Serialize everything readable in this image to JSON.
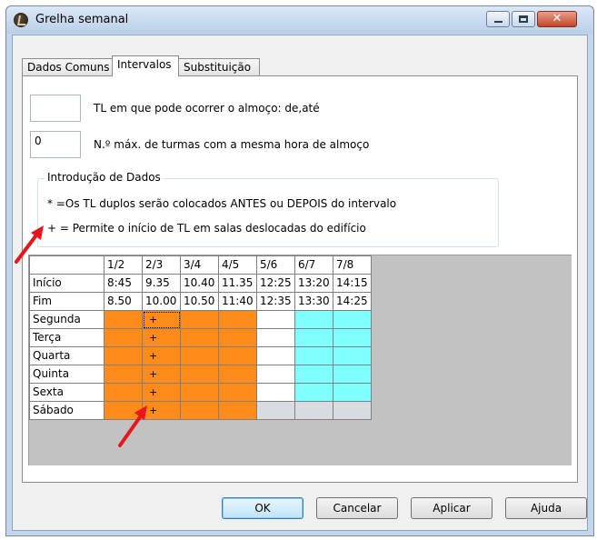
{
  "window": {
    "title": "Grelha semanal",
    "controls": {
      "minimize": "minimize",
      "maximize": "maximize",
      "close": "close"
    }
  },
  "tabs": [
    {
      "label": "Dados Comuns",
      "active": false
    },
    {
      "label": "Intervalos",
      "active": true
    },
    {
      "label": "Substituição",
      "active": false
    }
  ],
  "fields": {
    "lunch_range": {
      "value": "",
      "label": "TL em que pode ocorrer o almoço: de,até"
    },
    "max_classes": {
      "value": "0",
      "label": "N.º máx. de turmas com a mesma hora de almoço"
    }
  },
  "group": {
    "title": "Introdução de Dados",
    "line1": "* =Os TL duplos serão colocados ANTES ou DEPOIS do intervalo",
    "line2": "+ = Permite o início de TL em salas deslocadas do edifício"
  },
  "grid": {
    "columns": [
      "1/2",
      "2/3",
      "3/4",
      "4/5",
      "5/6",
      "6/7",
      "7/8"
    ],
    "time_rows": [
      {
        "label": "Início",
        "values": [
          "8:45",
          "9.35",
          "10.40",
          "11.35",
          "12:25",
          "13:20",
          "14:15"
        ]
      },
      {
        "label": "Fim",
        "values": [
          "8.50",
          "10.00",
          "10.50",
          "11:40",
          "12:35",
          "13:30",
          "14:25"
        ]
      }
    ],
    "day_rows": [
      {
        "label": "Segunda",
        "cells": [
          "orange",
          "orange+",
          "orange",
          "orange",
          "white",
          "cyan",
          "cyan"
        ]
      },
      {
        "label": "Terça",
        "cells": [
          "orange",
          "orange+",
          "orange",
          "orange",
          "white",
          "cyan",
          "cyan"
        ]
      },
      {
        "label": "Quarta",
        "cells": [
          "orange",
          "orange+",
          "orange",
          "orange",
          "white",
          "cyan",
          "cyan"
        ]
      },
      {
        "label": "Quinta",
        "cells": [
          "orange",
          "orange+",
          "orange",
          "orange",
          "white",
          "cyan",
          "cyan"
        ]
      },
      {
        "label": "Sexta",
        "cells": [
          "orange",
          "orange+",
          "orange",
          "orange",
          "white",
          "cyan",
          "cyan"
        ]
      },
      {
        "label": "Sábado",
        "cells": [
          "orange",
          "orange+",
          "orange",
          "orange",
          "gray",
          "gray",
          "gray"
        ]
      }
    ],
    "colors": {
      "orange": "#ff8c1a",
      "cyan": "#80ffff",
      "white": "#ffffff",
      "gray": "#d8dce0"
    }
  },
  "buttons": {
    "ok": "OK",
    "cancel": "Cancelar",
    "apply": "Aplicar",
    "help": "Ajuda"
  },
  "annotation_color": "#e8161c"
}
